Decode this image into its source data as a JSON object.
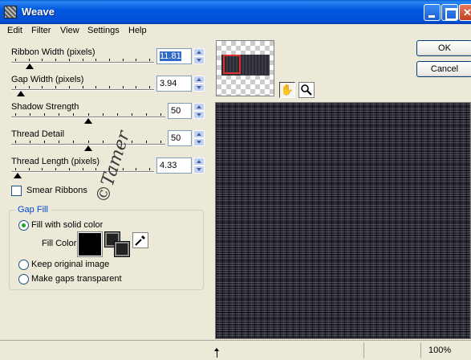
{
  "window": {
    "title": "Weave"
  },
  "menu": [
    "Edit",
    "Filter",
    "View",
    "Settings",
    "Help"
  ],
  "params": [
    {
      "label": "Ribbon Width (pixels)",
      "value": "11.81",
      "level": 0.11
    },
    {
      "label": "Gap Width (pixels)",
      "value": "3.94",
      "level": 0.04
    },
    {
      "label": "Shadow Strength",
      "value": "50",
      "level": 0.5
    },
    {
      "label": "Thread Detail",
      "value": "50",
      "level": 0.5
    },
    {
      "label": "Thread Length (pixels)",
      "value": "4.33",
      "level": 0.02
    }
  ],
  "smear_ribbons": {
    "label": "Smear Ribbons",
    "checked": false
  },
  "gap_fill": {
    "title": "Gap Fill",
    "option_solid": "Fill with solid color",
    "fill_color_label": "Fill Color",
    "fill_color": "#000000",
    "option_keep": "Keep original image",
    "option_transparent": "Make gaps transparent",
    "selected": "solid"
  },
  "watermark": "©Tamer",
  "buttons": {
    "ok": "OK",
    "cancel": "Cancel"
  },
  "tools": {
    "pan": "pan-hand-icon",
    "zoom": "magnifier-icon"
  },
  "status": {
    "zoom": "100%"
  },
  "colors": {
    "titlebar": "#0054e3",
    "accent": "#316ac5",
    "groupbox_title": "#0046d5"
  }
}
